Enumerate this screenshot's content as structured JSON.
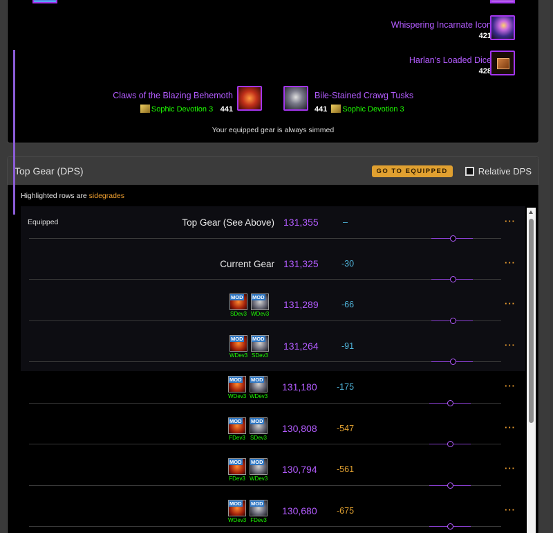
{
  "equipped_gear": {
    "items": [
      {
        "name": "Whispering Incarnate Icon",
        "ilvl": "421"
      },
      {
        "name": "Harlan's Loaded Dice",
        "ilvl": "428"
      },
      {
        "name": "Claws of the Blazing Behemoth",
        "gem": "Sophic Devotion 3",
        "ilvl": "441"
      },
      {
        "name": "Bile-Stained Crawg Tusks",
        "gem": "Sophic Devotion 3",
        "ilvl": "441"
      }
    ],
    "note": "Your equipped gear is always simmed"
  },
  "top_gear": {
    "title": "Top Gear (DPS)",
    "goto_label": "GO TO EQUIPPED",
    "relative_label": "Relative DPS",
    "highlight_prefix": "Highlighted rows are ",
    "highlight_word": "sidegrades",
    "more_label": "···",
    "rows": [
      {
        "label": "Equipped",
        "name": "Top Gear (See Above)",
        "dps": "131,355",
        "diff": "–"
      },
      {
        "name": "Current Gear",
        "dps": "131,325",
        "diff": "-30"
      },
      {
        "mods": [
          "SDev3",
          "WDev3"
        ],
        "dps": "131,289",
        "diff": "-66"
      },
      {
        "mods": [
          "WDev3",
          "SDev3"
        ],
        "dps": "131,264",
        "diff": "-91"
      },
      {
        "mods": [
          "WDev3",
          "WDev3"
        ],
        "dps": "131,180",
        "diff": "-175"
      },
      {
        "mods": [
          "FDev3",
          "SDev3"
        ],
        "dps": "130,808",
        "diff": "-547"
      },
      {
        "mods": [
          "FDev3",
          "WDev3"
        ],
        "dps": "130,794",
        "diff": "-561"
      },
      {
        "mods": [
          "WDev3",
          "FDev3"
        ],
        "dps": "130,680",
        "diff": "-675"
      }
    ],
    "mod_tag": "MOD"
  },
  "colors": {
    "epic": "#b35cff",
    "accent": "#e0a030",
    "gem": "#1eff00",
    "diff_small": "#4fb3d9"
  }
}
